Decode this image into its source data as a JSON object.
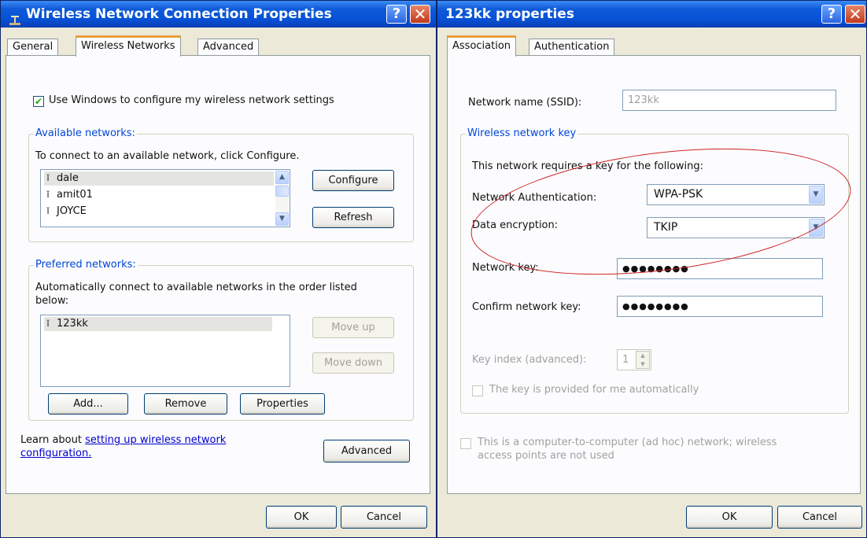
{
  "left": {
    "title": "Wireless Network Connection Properties",
    "help_glyph": "?",
    "close_glyph": "✕",
    "tabs": [
      "General",
      "Wireless Networks",
      "Advanced"
    ],
    "use_windows_label": "Use Windows to configure my wireless network settings",
    "use_windows_checked": true,
    "available": {
      "legend": "Available networks:",
      "desc": "To connect to an available network, click Configure.",
      "networks": [
        "dale",
        "amit01",
        "JOYCE"
      ],
      "configure": "Configure",
      "refresh": "Refresh"
    },
    "preferred": {
      "legend": "Preferred networks:",
      "desc_line1": "Automatically connect to available networks in the order listed",
      "desc_line2": "below:",
      "networks": [
        "123kk"
      ],
      "move_up": "Move up",
      "move_down": "Move down",
      "add": "Add...",
      "remove": "Remove",
      "properties": "Properties"
    },
    "learn_prefix": "Learn about ",
    "learn_link_1": "setting up wireless network",
    "learn_link_2": "configuration.",
    "advanced": "Advanced",
    "ok": "OK",
    "cancel": "Cancel"
  },
  "right": {
    "title": "123kk properties",
    "help_glyph": "?",
    "close_glyph": "✕",
    "tabs": [
      "Association",
      "Authentication"
    ],
    "ssid_label": "Network name (SSID):",
    "ssid_value": "123kk",
    "key_group": {
      "legend": "Wireless network key",
      "desc": "This network requires a key for the following:",
      "auth_label": "Network Authentication:",
      "auth_value": "WPA-PSK",
      "enc_label": "Data encryption:",
      "enc_value": "TKIP",
      "key_label": "Network key:",
      "key_value": "●●●●●●●●",
      "confirm_label": "Confirm network key:",
      "confirm_value": "●●●●●●●●",
      "index_label": "Key index (advanced):",
      "index_value": "1",
      "auto_label": "The key is provided for me automatically"
    },
    "adhoc_line1": "This is a computer-to-computer (ad hoc) network; wireless",
    "adhoc_line2": "access points are not used",
    "ok": "OK",
    "cancel": "Cancel"
  },
  "icons": [
    "network-connection-icon",
    "wireless-network-icon",
    "checkmark-icon",
    "scroll-up-icon",
    "scroll-down-icon",
    "dropdown-arrow-icon",
    "spin-up-icon",
    "spin-down-icon",
    "help-icon",
    "close-icon"
  ],
  "colors": {
    "titlebar": "#0751d6",
    "dialog": "#ece9d8",
    "accent_tab": "#e8a03d",
    "legend": "#0046d5",
    "annotation_ellipse": "#cc2222"
  }
}
